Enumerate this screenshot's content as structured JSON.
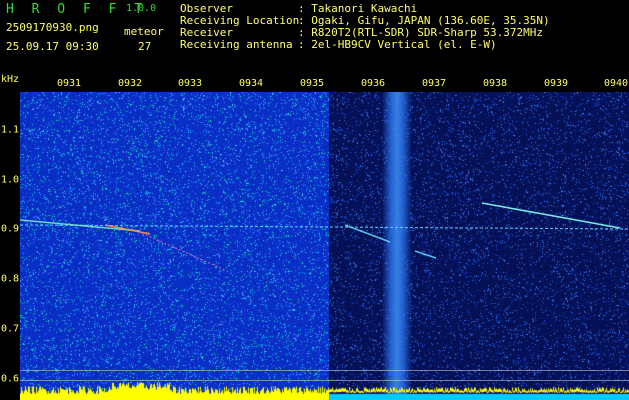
{
  "header": {
    "app_name": "H R O F F T",
    "app_version": "1.0.0",
    "filename": "2509170930.png",
    "datetime": "25.09.17 09:30",
    "meteor_label": "meteor",
    "meteor_count": "27",
    "info": [
      {
        "key": "Observer",
        "value": ": Takanori Kawachi"
      },
      {
        "key": "Receiving Location",
        "value": ": Ogaki, Gifu, JAPAN (136.60E, 35.35N)"
      },
      {
        "key": "Receiver",
        "value": ": R820T2(RTL-SDR) SDR-Sharp 53.372MHz"
      },
      {
        "key": "Receiving antenna",
        "value": ": 2el-HB9CV Vertical (el. E-W)"
      }
    ]
  },
  "axes": {
    "y_unit": "kHz",
    "y_labels": [
      "1.1",
      "1.0",
      "0.9",
      "0.8",
      "0.7",
      "0.6"
    ],
    "time_labels": [
      "0931",
      "0932",
      "0933",
      "0934",
      "0935",
      "0936",
      "0937",
      "0938",
      "0939",
      "0940"
    ]
  },
  "colors": {
    "label_yellow": "#ffff66",
    "title_green": "#33dd33",
    "panel_left": "#0a2fc6",
    "panel_right": "#051055",
    "trace_cyan": "#66ddff",
    "bar_yellow": "#ffff00",
    "bar_cyan": "#00ccff"
  }
}
